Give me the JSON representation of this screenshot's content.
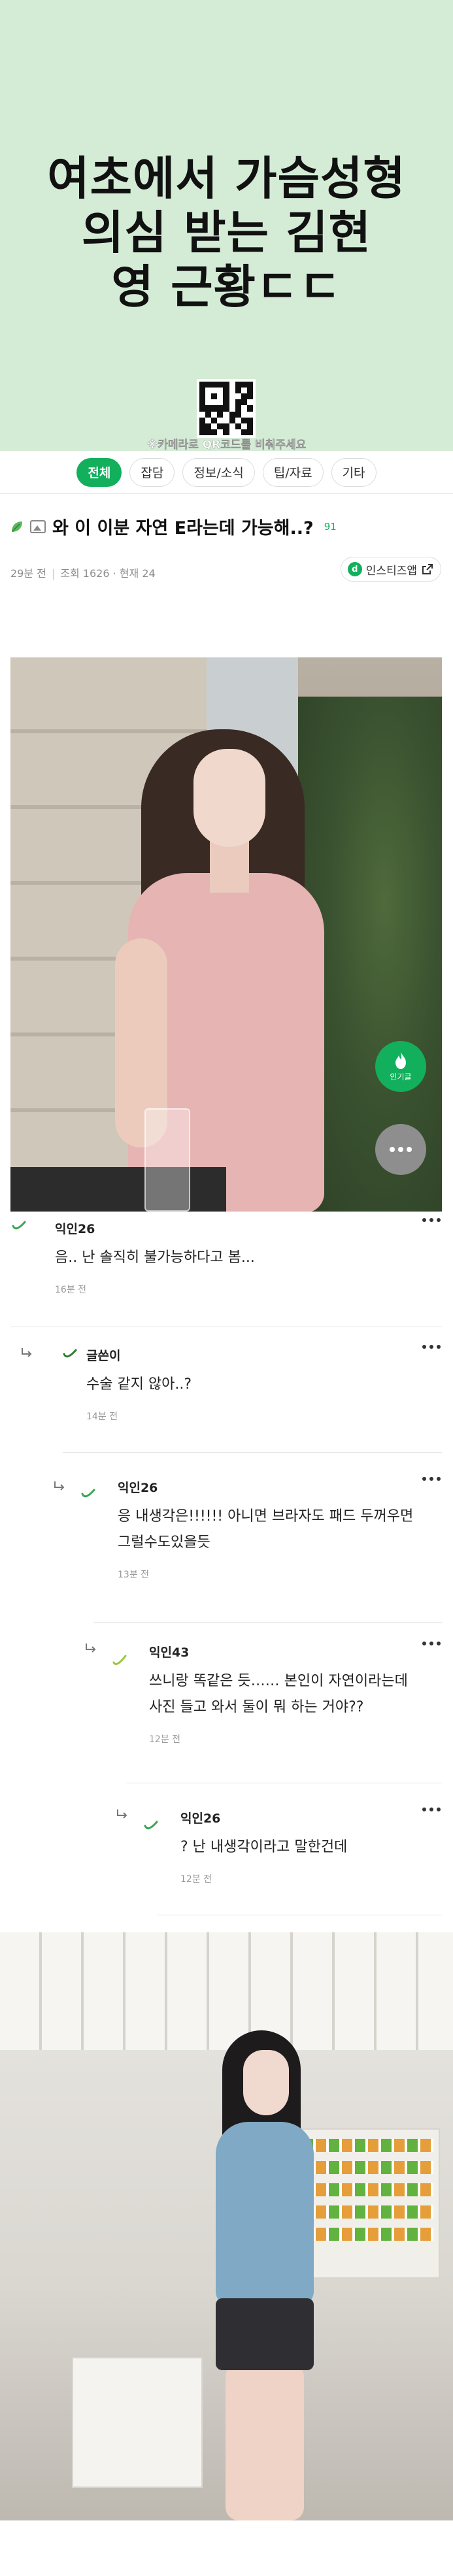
{
  "banner": {
    "title_lines": [
      "여초에서 가슴성형",
      "의심 받는 김현",
      "영 근황ㄷㄷ"
    ],
    "qr_caption": "※카메라로 QR코드를 비춰주세요"
  },
  "tabs": [
    {
      "label": "전체",
      "active": true
    },
    {
      "label": "잡담",
      "active": false
    },
    {
      "label": "정보/소식",
      "active": false
    },
    {
      "label": "팁/자료",
      "active": false
    },
    {
      "label": "기타",
      "active": false
    }
  ],
  "post": {
    "title": "와 이 이분 자연 E라는데 가능해..?",
    "comment_count": "91",
    "time": "29분 전",
    "views": "조회 1626",
    "current": "현재 24",
    "source": "인스티즈앱"
  },
  "fab": {
    "hot_label": "인기글"
  },
  "comments": [
    {
      "author": "익인26",
      "body": "음.. 난 솔직히 불가능하다고 봄...",
      "time": "16분 전"
    },
    {
      "author": "글쓴이",
      "body": "수술 같지 않아..?",
      "time": "14분 전"
    },
    {
      "author": "익인26",
      "body_lines": [
        "응 내생각은!!!!!! 아니면 브라자도 패드 두꺼우면",
        "그럴수도있을듯"
      ],
      "time": "13분 전"
    },
    {
      "author": "익인43",
      "body_lines": [
        "쓰니랑 똑같은 듯…… 본인이 자연이라는데",
        "사진 들고 와서 둘이 뭐 하는 거야??"
      ],
      "time": "12분 전"
    },
    {
      "author": "익인26",
      "body": "? 난 내생각이라고 말한건데",
      "time": "12분 전"
    }
  ],
  "colors": {
    "brand_green": "#12b05c",
    "banner_bg": "#d4ecd6"
  }
}
